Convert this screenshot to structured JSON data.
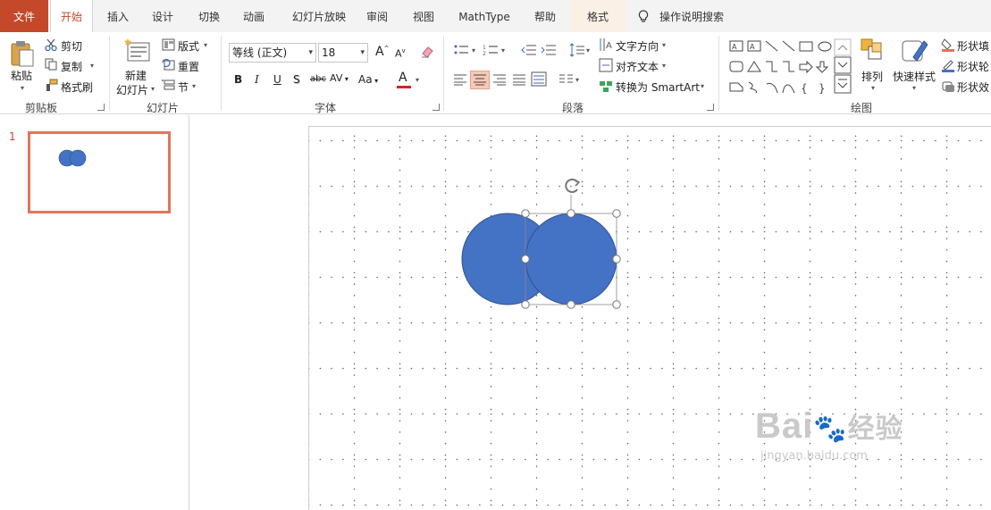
{
  "tabs": [
    {
      "key": "file",
      "label": "文件"
    },
    {
      "key": "home",
      "label": "开始",
      "active": true
    },
    {
      "key": "insert",
      "label": "插入"
    },
    {
      "key": "design",
      "label": "设计"
    },
    {
      "key": "transitions",
      "label": "切换"
    },
    {
      "key": "animations",
      "label": "动画"
    },
    {
      "key": "slideshow",
      "label": "幻灯片放映"
    },
    {
      "key": "review",
      "label": "审阅"
    },
    {
      "key": "view",
      "label": "视图"
    },
    {
      "key": "mathtype",
      "label": "MathType"
    },
    {
      "key": "help",
      "label": "帮助"
    },
    {
      "key": "format",
      "label": "格式"
    }
  ],
  "tell_me": "操作说明搜索",
  "clipboard": {
    "paste": "粘贴",
    "cut": "剪切",
    "copy": "复制",
    "format_painter": "格式刷",
    "label": "剪贴板"
  },
  "slides_group": {
    "new_slide_1": "新建",
    "new_slide_2": "幻灯片",
    "layout": "版式",
    "reset": "重置",
    "section": "节",
    "label": "幻灯片"
  },
  "font": {
    "name": "等线 (正文)",
    "size": "18",
    "grow": "A",
    "shrink": "A",
    "bold": "B",
    "italic": "I",
    "underline": "U",
    "shadow": "S",
    "strike": "abc",
    "spacing": "AV",
    "case": "Aa",
    "color_a": "A",
    "label": "字体"
  },
  "paragraph": {
    "text_direction": "文字方向",
    "align_text": "对齐文本",
    "smartart": "转换为 SmartArt",
    "label": "段落"
  },
  "drawing": {
    "arrange": "排列",
    "quick_styles": "快速样式",
    "shape_fill": "形状填",
    "shape_outline": "形状轮",
    "shape_effects": "形状效",
    "label": "绘图"
  },
  "slide_panel": {
    "number": "1"
  },
  "watermark": {
    "brand": "Bai",
    "brand2": "经验",
    "url": "jingyan.baidu.com"
  },
  "colors": {
    "accent": "#c4492a",
    "shape_fill": "#4472c4",
    "shape_stroke": "#2f528f"
  }
}
